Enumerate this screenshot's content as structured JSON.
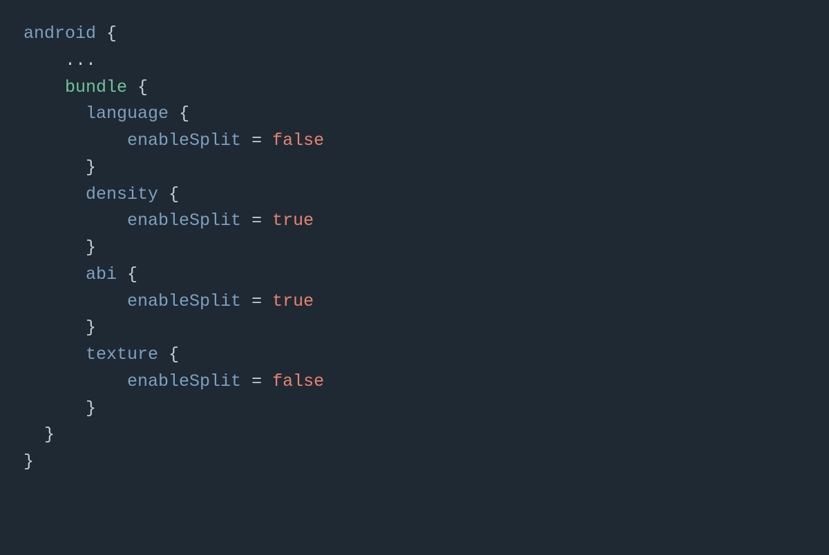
{
  "code": {
    "root_block": "android",
    "ellipsis": "...",
    "bundle_block": "bundle",
    "open_brace": "{",
    "close_brace": "}",
    "equals": "=",
    "splits": [
      {
        "name": "language",
        "prop": "enableSplit",
        "value": "false"
      },
      {
        "name": "density",
        "prop": "enableSplit",
        "value": "true"
      },
      {
        "name": "abi",
        "prop": "enableSplit",
        "value": "true"
      },
      {
        "name": "texture",
        "prop": "enableSplit",
        "value": "false"
      }
    ]
  }
}
